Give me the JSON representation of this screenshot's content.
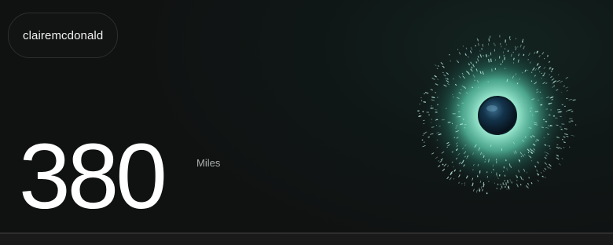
{
  "user": {
    "username": "clairemcdonald"
  },
  "stat": {
    "value": "380",
    "unit": "Miles"
  },
  "orb": {
    "icon": "particle-globe-icon",
    "colors": {
      "glow": "#7fe3c6",
      "particle": "#bff3e4",
      "core": "#0b1b2a"
    }
  }
}
